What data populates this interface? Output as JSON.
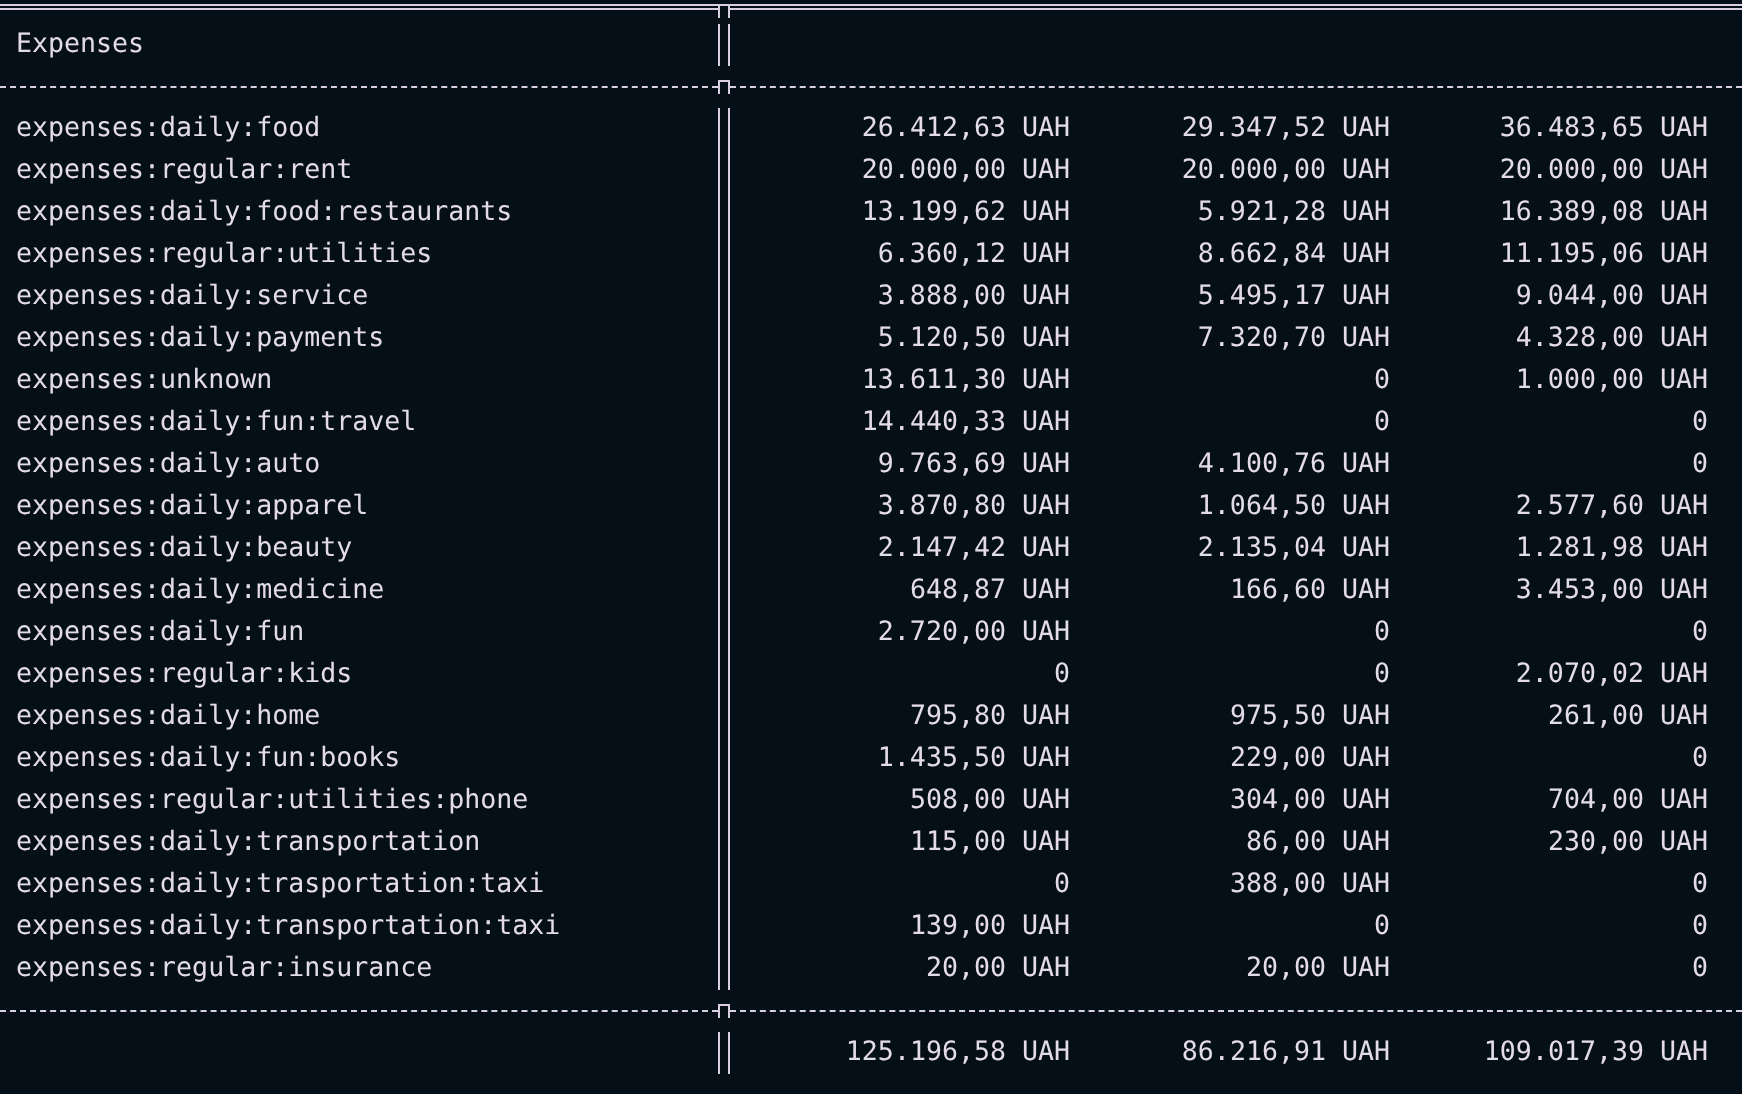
{
  "report": {
    "title": "Expenses",
    "rows": [
      {
        "account": "expenses:daily:food",
        "values": [
          "26.412,63 UAH",
          "29.347,52 UAH",
          "36.483,65 UAH"
        ]
      },
      {
        "account": "expenses:regular:rent",
        "values": [
          "20.000,00 UAH",
          "20.000,00 UAH",
          "20.000,00 UAH"
        ]
      },
      {
        "account": "expenses:daily:food:restaurants",
        "values": [
          "13.199,62 UAH",
          "5.921,28 UAH",
          "16.389,08 UAH"
        ]
      },
      {
        "account": "expenses:regular:utilities",
        "values": [
          "6.360,12 UAH",
          "8.662,84 UAH",
          "11.195,06 UAH"
        ]
      },
      {
        "account": "expenses:daily:service",
        "values": [
          "3.888,00 UAH",
          "5.495,17 UAH",
          "9.044,00 UAH"
        ]
      },
      {
        "account": "expenses:daily:payments",
        "values": [
          "5.120,50 UAH",
          "7.320,70 UAH",
          "4.328,00 UAH"
        ]
      },
      {
        "account": "expenses:unknown",
        "values": [
          "13.611,30 UAH",
          "0",
          "1.000,00 UAH"
        ]
      },
      {
        "account": "expenses:daily:fun:travel",
        "values": [
          "14.440,33 UAH",
          "0",
          "0"
        ]
      },
      {
        "account": "expenses:daily:auto",
        "values": [
          "9.763,69 UAH",
          "4.100,76 UAH",
          "0"
        ]
      },
      {
        "account": "expenses:daily:apparel",
        "values": [
          "3.870,80 UAH",
          "1.064,50 UAH",
          "2.577,60 UAH"
        ]
      },
      {
        "account": "expenses:daily:beauty",
        "values": [
          "2.147,42 UAH",
          "2.135,04 UAH",
          "1.281,98 UAH"
        ]
      },
      {
        "account": "expenses:daily:medicine",
        "values": [
          "648,87 UAH",
          "166,60 UAH",
          "3.453,00 UAH"
        ]
      },
      {
        "account": "expenses:daily:fun",
        "values": [
          "2.720,00 UAH",
          "0",
          "0"
        ]
      },
      {
        "account": "expenses:regular:kids",
        "values": [
          "0",
          "0",
          "2.070,02 UAH"
        ]
      },
      {
        "account": "expenses:daily:home",
        "values": [
          "795,80 UAH",
          "975,50 UAH",
          "261,00 UAH"
        ]
      },
      {
        "account": "expenses:daily:fun:books",
        "values": [
          "1.435,50 UAH",
          "229,00 UAH",
          "0"
        ]
      },
      {
        "account": "expenses:regular:utilities:phone",
        "values": [
          "508,00 UAH",
          "304,00 UAH",
          "704,00 UAH"
        ]
      },
      {
        "account": "expenses:daily:transportation",
        "values": [
          "115,00 UAH",
          "86,00 UAH",
          "230,00 UAH"
        ]
      },
      {
        "account": "expenses:daily:trasportation:taxi",
        "values": [
          "0",
          "388,00 UAH",
          "0"
        ]
      },
      {
        "account": "expenses:daily:transportation:taxi",
        "values": [
          "139,00 UAH",
          "0",
          "0"
        ]
      },
      {
        "account": "expenses:regular:insurance",
        "values": [
          "20,00 UAH",
          "20,00 UAH",
          "0"
        ]
      }
    ],
    "totals": [
      "125.196,58 UAH",
      "86.216,91 UAH",
      "109.017,39 UAH"
    ]
  }
}
